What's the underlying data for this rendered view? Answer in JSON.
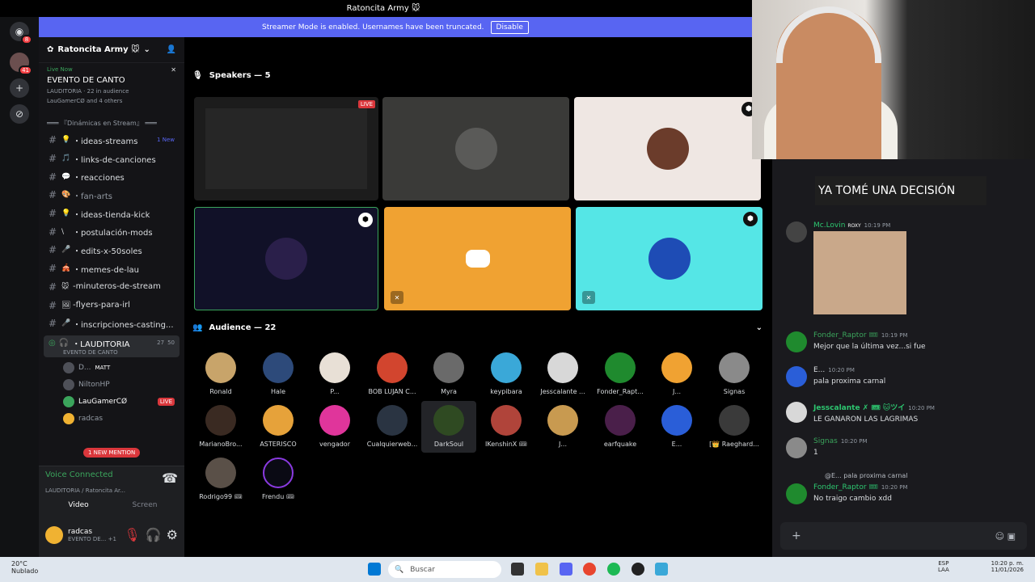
{
  "window": {
    "title": "Ratoncita Army 🐭"
  },
  "rail": {
    "badges": [
      "8",
      "41"
    ]
  },
  "banner": {
    "text": "Streamer Mode is enabled. Usernames have been truncated.",
    "button": "Disable"
  },
  "server": {
    "name": "Ratoncita Army 🐭"
  },
  "live": {
    "label": "Live Now",
    "event": "EVENTO DE CANTO",
    "stage": "LAUDITORIA",
    "audience": "22 in audience",
    "others": "LauGamerCØ and 4 others"
  },
  "category": "═══ 『Dinámicas en Stream』 ═══",
  "channels": [
    {
      "emoji": "💡",
      "name": "・ideas-streams",
      "badge": "1 New"
    },
    {
      "emoji": "🎵",
      "name": "・links-de-canciones",
      "badge": ""
    },
    {
      "emoji": "💬",
      "name": "・reacciones",
      "badge": ""
    },
    {
      "emoji": "🎨",
      "name": "・fan-arts",
      "badge": ""
    },
    {
      "emoji": "💡",
      "name": "・ideas-tienda-kick",
      "badge": ""
    },
    {
      "emoji": "\\",
      "name": "・postulación-mods",
      "badge": ""
    },
    {
      "emoji": "🎤",
      "name": "・edits-x-50soles",
      "badge": ""
    },
    {
      "emoji": "🎪",
      "name": "・memes-de-lau",
      "badge": ""
    },
    {
      "emoji": "🐭",
      "name": "-minuteros-de-stream",
      "badge": ""
    },
    {
      "emoji": "🖼",
      "name": "-flyers-para-irl",
      "badge": ""
    },
    {
      "emoji": "🎤",
      "name": "・inscripciones-casting...",
      "badge": ""
    }
  ],
  "voice_channel": {
    "name": "・LAUDITORIA",
    "sub": "EVENTO DE CANTO",
    "count_a": "27",
    "count_b": "50",
    "users": [
      {
        "name": "D...",
        "tag": "MATT"
      },
      {
        "name": "NiltonHP",
        "tag": ""
      },
      {
        "name": "LauGamerCØ",
        "tag": "LIVE"
      },
      {
        "name": "radcas",
        "tag": ""
      }
    ],
    "mention": "1 NEW MENTION"
  },
  "voice_connected": {
    "title": "Voice Connected",
    "sub": "LAUDITORIA / Ratoncita Ar...",
    "video": "Video",
    "screen": "Screen"
  },
  "user": {
    "name": "radcas",
    "status": "EVENTO DE...",
    "plus": "+1"
  },
  "stage": {
    "speakers_label": "Speakers — 5",
    "audience_label": "Audience — 22",
    "live_badge": "LIVE"
  },
  "audience": [
    "Ronald",
    "Hale",
    "P...",
    "BOB LUJAN C...",
    "Myra",
    "keypibara",
    "Jesscalante ...",
    "Fonder_Rapt...",
    "J...",
    "Signas",
    "MarianoBro...",
    "ASTERISCO",
    "vengador",
    "Cualquierweb...",
    "DarkSoul",
    "IKenshinX 🎟",
    "J...",
    "earfquake",
    "E...",
    "[👑 Raeghard...",
    "Rodrigo99 🎟",
    "Frendu 🎟"
  ],
  "chat": {
    "banner": "YA TOMÉ UNA DECISIÓN",
    "messages": [
      {
        "name": "Mc.Lovin",
        "badge": "ROXY",
        "time": "10:19 PM",
        "text": ""
      },
      {
        "name": "Fonder_Raptor 🎟",
        "badge": "",
        "time": "10:19 PM",
        "text": "Mejor que la última vez...si fue"
      },
      {
        "name": "E...",
        "badge": "",
        "time": "10:20 PM",
        "text": "pala proxima carnal"
      },
      {
        "name": "Jesscalante ✗ 🎟 🐱ツイ",
        "badge": "",
        "time": "10:20 PM",
        "text": "LE GANARON LAS LAGRIMAS"
      },
      {
        "name": "Signas",
        "badge": "",
        "time": "10:20 PM",
        "text": "1"
      },
      {
        "name": "Fonder_Raptor 🎟",
        "badge": "",
        "time": "10:20 PM",
        "text": "No traigo cambio xdd"
      }
    ],
    "reply": "@E... pala proxima carnal"
  },
  "taskbar": {
    "temp": "20°C",
    "weather": "Nublado",
    "search": "Buscar",
    "lang_a": "ESP",
    "lang_b": "LAA",
    "time": "10:20 p. m.",
    "date": "11/01/2026"
  }
}
